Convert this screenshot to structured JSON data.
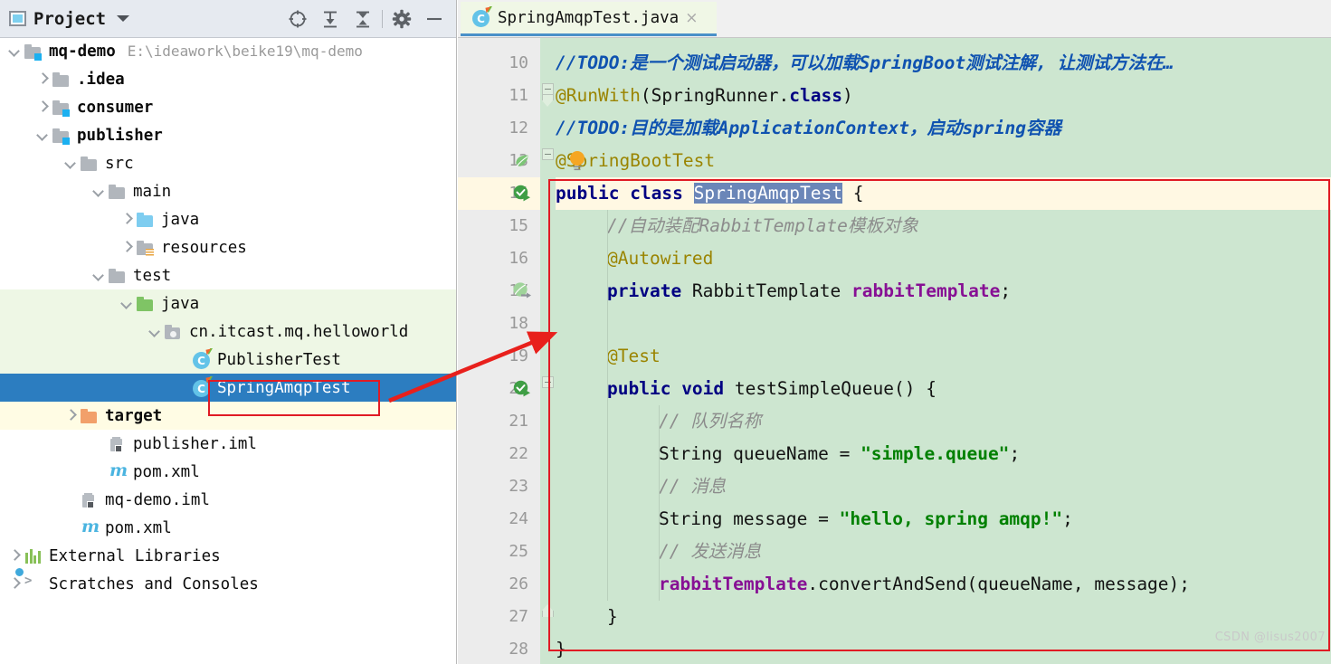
{
  "panel": {
    "title": "Project",
    "icons": [
      "project-icon",
      "chevron-down-icon",
      "locate-icon",
      "expand-all-icon",
      "collapse-all-icon",
      "settings-gear-icon",
      "minimize-icon"
    ],
    "tree": [
      {
        "label": "mq-demo",
        "sub": "E:\\ideawork\\beike19\\mq-demo",
        "depth": 0,
        "arrow": "down",
        "icon": "module-folder-icon",
        "bold": true,
        "bg": "none"
      },
      {
        "label": ".idea",
        "sub": "",
        "depth": 1,
        "arrow": "right",
        "icon": "folder-icon",
        "bold": true,
        "bg": "none"
      },
      {
        "label": "consumer",
        "sub": "",
        "depth": 1,
        "arrow": "right",
        "icon": "module-folder-icon",
        "bold": true,
        "bg": "none"
      },
      {
        "label": "publisher",
        "sub": "",
        "depth": 1,
        "arrow": "down",
        "icon": "module-folder-icon",
        "bold": true,
        "bg": "none"
      },
      {
        "label": "src",
        "sub": "",
        "depth": 2,
        "arrow": "down",
        "icon": "folder-icon",
        "bold": false,
        "bg": "none"
      },
      {
        "label": "main",
        "sub": "",
        "depth": 3,
        "arrow": "down",
        "icon": "folder-icon",
        "bold": false,
        "bg": "none"
      },
      {
        "label": "java",
        "sub": "",
        "depth": 4,
        "arrow": "right",
        "icon": "source-root-folder-icon",
        "bold": false,
        "bg": "none"
      },
      {
        "label": "resources",
        "sub": "",
        "depth": 4,
        "arrow": "right",
        "icon": "resources-folder-icon",
        "bold": false,
        "bg": "none"
      },
      {
        "label": "test",
        "sub": "",
        "depth": 3,
        "arrow": "down",
        "icon": "folder-icon",
        "bold": false,
        "bg": "none"
      },
      {
        "label": "java",
        "sub": "",
        "depth": 4,
        "arrow": "down",
        "icon": "test-source-root-folder-icon",
        "bold": false,
        "bg": "green"
      },
      {
        "label": "cn.itcast.mq.helloworld",
        "sub": "",
        "depth": 5,
        "arrow": "down",
        "icon": "package-icon",
        "bold": false,
        "bg": "green"
      },
      {
        "label": "PublisherTest",
        "sub": "",
        "depth": 6,
        "arrow": "none",
        "icon": "java-test-class-icon",
        "bold": false,
        "bg": "green"
      },
      {
        "label": "SpringAmqpTest",
        "sub": "",
        "depth": 6,
        "arrow": "none",
        "icon": "java-test-class-icon",
        "bold": false,
        "bg": "selected"
      },
      {
        "label": "target",
        "sub": "",
        "depth": 2,
        "arrow": "right",
        "icon": "excluded-folder-icon",
        "bold": true,
        "bg": "yellow"
      },
      {
        "label": "publisher.iml",
        "sub": "",
        "depth": 3,
        "arrow": "none",
        "icon": "iml-file-icon",
        "bold": false,
        "bg": "none"
      },
      {
        "label": "pom.xml",
        "sub": "",
        "depth": 3,
        "arrow": "none",
        "icon": "maven-file-icon",
        "bold": false,
        "bg": "none"
      },
      {
        "label": "mq-demo.iml",
        "sub": "",
        "depth": 2,
        "arrow": "none",
        "icon": "iml-file-icon",
        "bold": false,
        "bg": "none"
      },
      {
        "label": "pom.xml",
        "sub": "",
        "depth": 2,
        "arrow": "none",
        "icon": "maven-file-icon",
        "bold": false,
        "bg": "none"
      },
      {
        "label": "External Libraries",
        "sub": "",
        "depth": 0,
        "arrow": "right",
        "icon": "external-libraries-icon",
        "bold": false,
        "bg": "none"
      },
      {
        "label": "Scratches and Consoles",
        "sub": "",
        "depth": 0,
        "arrow": "right",
        "icon": "scratches-icon",
        "bold": false,
        "bg": "none"
      }
    ]
  },
  "editor": {
    "tab": {
      "label": "SpringAmqpTest.java",
      "icon": "java-test-class-icon",
      "close": "×"
    },
    "watermark": "CSDN @lisus2007",
    "caret_line": 14,
    "selected_word": "SpringAmqpTest",
    "lines": [
      {
        "n": 10,
        "gutter": "",
        "fold": "",
        "indent": 0,
        "tokens": [
          {
            "t": "//TODO:是一个测试启动器，可以加载SpringBoot测试注解, 让测试方法在…",
            "c": "todo"
          }
        ]
      },
      {
        "n": 11,
        "gutter": "",
        "fold": "start",
        "indent": 0,
        "tokens": [
          {
            "t": "@RunWith",
            "c": "anno"
          },
          {
            "t": "(SpringRunner.",
            "c": "pl"
          },
          {
            "t": "class",
            "c": "kw"
          },
          {
            "t": ")",
            "c": "pl"
          }
        ]
      },
      {
        "n": 12,
        "gutter": "",
        "fold": "",
        "indent": 0,
        "tokens": [
          {
            "t": "//TODO:目的是加载ApplicationContext，启动spring容器",
            "c": "todo"
          }
        ]
      },
      {
        "n": 13,
        "gutter": "spring-leaf-icon",
        "fold": "start2",
        "indent": 0,
        "tokens": [
          {
            "t": "@SpringBootTest",
            "c": "anno"
          }
        ]
      },
      {
        "n": 14,
        "gutter": "run-test-icon",
        "fold": "",
        "indent": 0,
        "tokens": [
          {
            "t": "public ",
            "c": "kw"
          },
          {
            "t": "class ",
            "c": "kw"
          },
          {
            "t": "SpringAmqpTest",
            "c": "sel-word"
          },
          {
            "t": " {",
            "c": "pl"
          }
        ]
      },
      {
        "n": 15,
        "gutter": "",
        "fold": "",
        "indent": 1,
        "tokens": [
          {
            "t": "//自动装配RabbitTemplate模板对象",
            "c": "cmt"
          }
        ]
      },
      {
        "n": 16,
        "gutter": "",
        "fold": "",
        "indent": 1,
        "tokens": [
          {
            "t": "@Autowired",
            "c": "anno"
          }
        ]
      },
      {
        "n": 17,
        "gutter": "autowire-bean-icon",
        "fold": "",
        "indent": 1,
        "tokens": [
          {
            "t": "private ",
            "c": "kw"
          },
          {
            "t": "RabbitTemplate ",
            "c": "pl"
          },
          {
            "t": "rabbitTemplate",
            "c": "fld"
          },
          {
            "t": ";",
            "c": "pl"
          }
        ]
      },
      {
        "n": 18,
        "gutter": "",
        "fold": "",
        "indent": 1,
        "tokens": []
      },
      {
        "n": 19,
        "gutter": "",
        "fold": "",
        "indent": 1,
        "tokens": [
          {
            "t": "@Test",
            "c": "anno"
          }
        ]
      },
      {
        "n": 20,
        "gutter": "run-test-icon",
        "fold": "start3",
        "indent": 1,
        "tokens": [
          {
            "t": "public ",
            "c": "kw"
          },
          {
            "t": "void ",
            "c": "kw"
          },
          {
            "t": "testSimpleQueue() {",
            "c": "pl"
          }
        ]
      },
      {
        "n": 21,
        "gutter": "",
        "fold": "",
        "indent": 2,
        "tokens": [
          {
            "t": "// 队列名称",
            "c": "cmt"
          }
        ]
      },
      {
        "n": 22,
        "gutter": "",
        "fold": "",
        "indent": 2,
        "tokens": [
          {
            "t": "String queueName = ",
            "c": "pl"
          },
          {
            "t": "\"simple.queue\"",
            "c": "str"
          },
          {
            "t": ";",
            "c": "pl"
          }
        ]
      },
      {
        "n": 23,
        "gutter": "",
        "fold": "",
        "indent": 2,
        "tokens": [
          {
            "t": "// 消息",
            "c": "cmt"
          }
        ]
      },
      {
        "n": 24,
        "gutter": "",
        "fold": "",
        "indent": 2,
        "tokens": [
          {
            "t": "String message = ",
            "c": "pl"
          },
          {
            "t": "\"hello, spring amqp!\"",
            "c": "str"
          },
          {
            "t": ";",
            "c": "pl"
          }
        ]
      },
      {
        "n": 25,
        "gutter": "",
        "fold": "",
        "indent": 2,
        "tokens": [
          {
            "t": "// 发送消息",
            "c": "cmt"
          }
        ]
      },
      {
        "n": 26,
        "gutter": "",
        "fold": "",
        "indent": 2,
        "tokens": [
          {
            "t": "rabbitTemplate",
            "c": "fld"
          },
          {
            "t": ".convertAndSend(queueName, message);",
            "c": "pl"
          }
        ]
      },
      {
        "n": 27,
        "gutter": "",
        "fold": "end3",
        "indent": 1,
        "tokens": [
          {
            "t": "}",
            "c": "pl"
          }
        ]
      },
      {
        "n": 28,
        "gutter": "",
        "fold": "",
        "indent": 0,
        "tokens": [
          {
            "t": "}",
            "c": "pl"
          }
        ]
      }
    ]
  },
  "annotations": {
    "code_rect_color": "#e01b24",
    "tree_rect_color": "#e01b24",
    "arrow_color": "#e8201c"
  }
}
